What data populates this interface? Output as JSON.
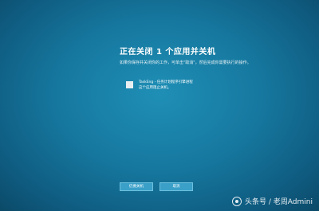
{
  "title": "正在关闭 1 个应用并关机",
  "subtitle": "如果你保存并关闭你的工作，可单击\"取消\"，然后完成你需要执行的操作。",
  "apps": [
    {
      "name": "TaskEng - 任务计划程序引擎进程",
      "status": "这个应用阻止关机。"
    }
  ],
  "buttons": {
    "force_shutdown": "仍要关机",
    "cancel": "取消"
  },
  "watermark": "头条号 / 老周Admini",
  "colors": {
    "background": "#16789f",
    "button": "#3aa0c8",
    "text": "#ffffff"
  }
}
